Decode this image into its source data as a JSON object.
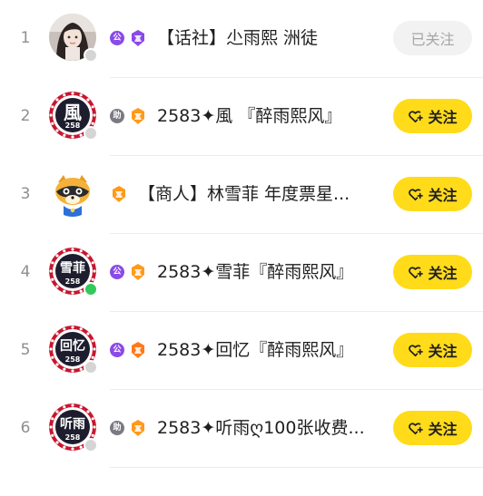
{
  "colors": {
    "accent_yellow": "#ffdb1a",
    "followed_bg": "#f2f2f2",
    "followed_text": "#a6a6a6",
    "rank_text": "#8e8e93",
    "online_green": "#34c759",
    "offline_gray": "#d5d5d5",
    "divider": "#ececec"
  },
  "rows": [
    {
      "rank": "1",
      "name": "【话社】尐雨熙 洲徒",
      "ellipsis": "",
      "badge_letter": "公",
      "badge_color": "#8a4ae8",
      "gem_color": "#8a4ae8",
      "status": "offline",
      "avatar": "person-photo",
      "button": {
        "label": "已关注",
        "state": "followed",
        "icon": ""
      }
    },
    {
      "rank": "2",
      "name": "2583✦風 『醉雨熙风』",
      "ellipsis": "",
      "badge_letter": "助",
      "badge_color": "#7a7a85",
      "gem_color": "#ff9a1a",
      "status": "offline",
      "avatar": "emblem",
      "avatar_char": "風",
      "avatar_num": "258",
      "button": {
        "label": "关注",
        "state": "follow",
        "icon": "heart-plus-icon"
      }
    },
    {
      "rank": "3",
      "name": "【商人】林雪菲 年度票星",
      "ellipsis": "...",
      "badge_letter": "",
      "badge_color": "",
      "gem_color": "#ff9a1a",
      "status": "none",
      "avatar": "raccoon",
      "button": {
        "label": "关注",
        "state": "follow",
        "icon": "heart-plus-icon"
      }
    },
    {
      "rank": "4",
      "name": "2583✦雪菲『醉雨熙风』",
      "ellipsis": "",
      "badge_letter": "公",
      "badge_color": "#8a4ae8",
      "gem_color": "#ff9a1a",
      "status": "online",
      "avatar": "emblem",
      "avatar_char": "雪菲",
      "avatar_num": "258",
      "button": {
        "label": "关注",
        "state": "follow",
        "icon": "heart-plus-icon"
      }
    },
    {
      "rank": "5",
      "name": "2583✦回忆『醉雨熙风』",
      "ellipsis": "",
      "badge_letter": "公",
      "badge_color": "#8a4ae8",
      "gem_color": "#ff7a1a",
      "status": "offline",
      "avatar": "emblem",
      "avatar_char": "回忆",
      "avatar_num": "258",
      "button": {
        "label": "关注",
        "state": "follow",
        "icon": "heart-plus-icon"
      }
    },
    {
      "rank": "6",
      "name": "2583✦听雨ღ100张收费",
      "ellipsis": "...",
      "badge_letter": "助",
      "badge_color": "#7a7a85",
      "gem_color": "#ff9a1a",
      "status": "offline",
      "avatar": "emblem",
      "avatar_char": "听雨",
      "avatar_num": "258",
      "button": {
        "label": "关注",
        "state": "follow",
        "icon": "heart-plus-icon"
      }
    }
  ]
}
